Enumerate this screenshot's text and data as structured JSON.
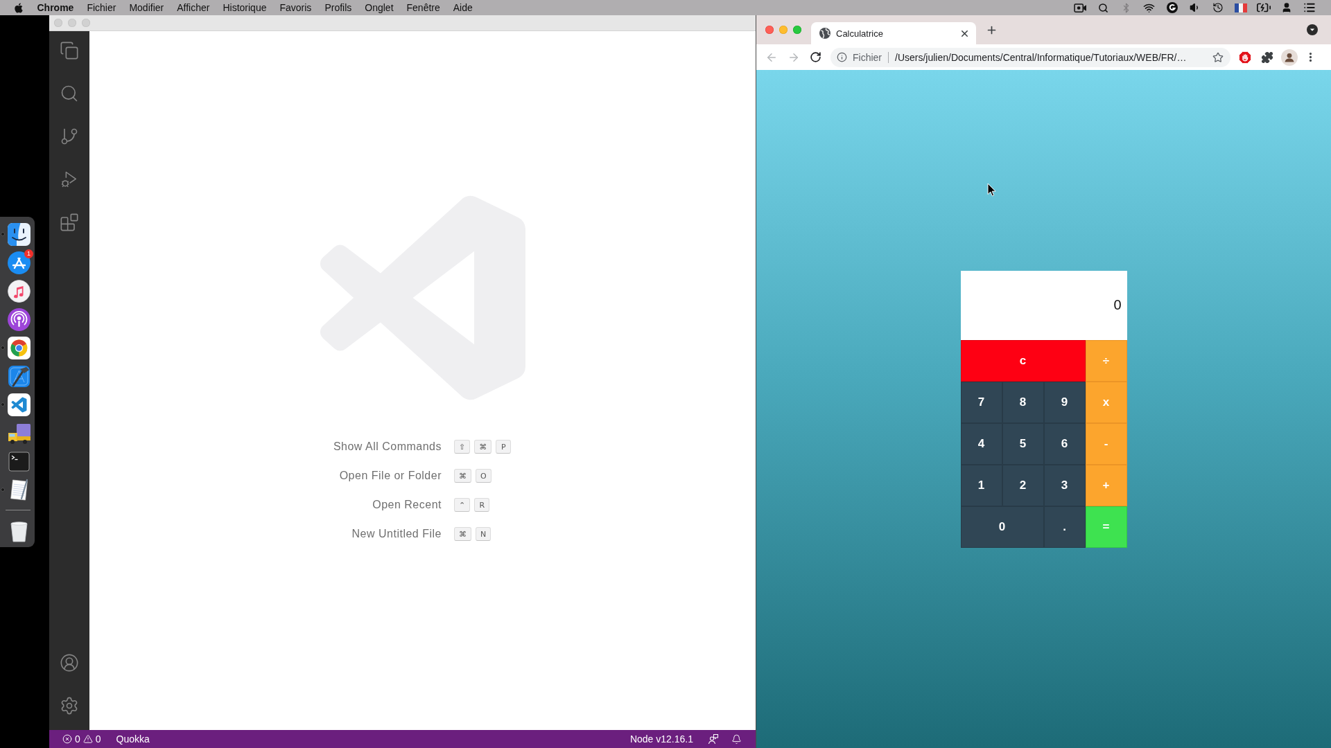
{
  "menu_bar": {
    "app_name": "Chrome",
    "menus": [
      "Fichier",
      "Modifier",
      "Afficher",
      "Historique",
      "Favoris",
      "Profils",
      "Onglet",
      "Fenêtre",
      "Aide"
    ]
  },
  "dock": {
    "items": [
      {
        "kind": "finder",
        "running": true
      },
      {
        "kind": "app_store",
        "running": false,
        "badge": "1"
      },
      {
        "kind": "music",
        "running": false
      },
      {
        "kind": "podcasts",
        "running": false
      },
      {
        "kind": "chrome",
        "running": true
      },
      {
        "kind": "xcode",
        "running": false
      },
      {
        "kind": "vscode",
        "running": true
      },
      {
        "kind": "truck",
        "running": false
      },
      {
        "kind": "terminal",
        "running": false
      },
      {
        "kind": "textedit",
        "running": true
      },
      {
        "kind": "trash",
        "running": false
      }
    ]
  },
  "editor": {
    "commands": [
      {
        "label": "Show All Commands",
        "keys": [
          "⇧",
          "⌘",
          "P"
        ]
      },
      {
        "label": "Open File or Folder",
        "keys": [
          "⌘",
          "O"
        ]
      },
      {
        "label": "Open Recent",
        "keys": [
          "⌃",
          "R"
        ]
      },
      {
        "label": "New Untitled File",
        "keys": [
          "⌘",
          "N"
        ]
      }
    ]
  },
  "status_bar": {
    "errors": "0",
    "warnings": "0",
    "items_left": [
      "Quokka"
    ],
    "items_right": [
      "Node v12.16.1"
    ]
  },
  "browser": {
    "tabs": [
      {
        "title": "Calculatrice",
        "selected": true
      }
    ],
    "back": {
      "disabled": true
    },
    "forward": {
      "disabled": true
    },
    "address": {
      "scheme": "Fichier",
      "url": "/Users/julien/Documents/Central/Informatique/Tutoriaux/WEB/FR/…"
    }
  },
  "calculator": {
    "display": "0",
    "keys": [
      {
        "label": "c",
        "kind": "clear"
      },
      {
        "label": "÷",
        "kind": "operator"
      },
      {
        "label": "7",
        "kind": "digit"
      },
      {
        "label": "8",
        "kind": "digit"
      },
      {
        "label": "9",
        "kind": "digit"
      },
      {
        "label": "x",
        "kind": "operator"
      },
      {
        "label": "4",
        "kind": "digit"
      },
      {
        "label": "5",
        "kind": "digit"
      },
      {
        "label": "6",
        "kind": "digit"
      },
      {
        "label": "-",
        "kind": "operator"
      },
      {
        "label": "1",
        "kind": "digit"
      },
      {
        "label": "2",
        "kind": "digit"
      },
      {
        "label": "3",
        "kind": "digit"
      },
      {
        "label": "+",
        "kind": "operator"
      },
      {
        "label": "0",
        "kind": "digit_wide"
      },
      {
        "label": ".",
        "kind": "digit"
      },
      {
        "label": "=",
        "kind": "equals"
      }
    ]
  }
}
